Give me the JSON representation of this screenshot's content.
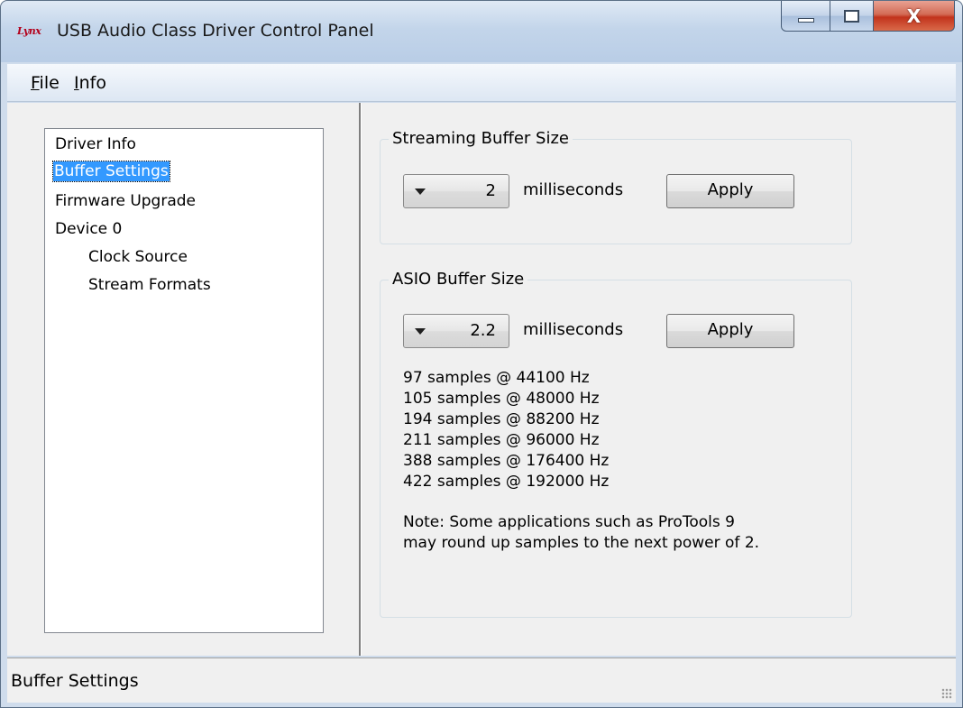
{
  "window": {
    "logo_text": "Lynx",
    "title": "USB Audio Class Driver Control Panel",
    "close_glyph": "X"
  },
  "menu": {
    "file_acc": "F",
    "file_rest": "ile",
    "info_acc": "I",
    "info_rest": "nfo"
  },
  "tree": {
    "items": [
      {
        "label": "Driver Info"
      },
      {
        "label": "Buffer Settings",
        "selected": true
      },
      {
        "label": "Firmware Upgrade"
      },
      {
        "label": "Device 0"
      },
      {
        "label": "Clock Source"
      },
      {
        "label": "Stream Formats"
      }
    ]
  },
  "streaming": {
    "group_label": "Streaming Buffer Size",
    "value": "2",
    "unit": "milliseconds",
    "apply_label": "Apply"
  },
  "asio": {
    "group_label": "ASIO Buffer Size",
    "value": "2.2",
    "unit": "milliseconds",
    "apply_label": "Apply",
    "samples": [
      "97 samples @ 44100 Hz",
      "105 samples @ 48000 Hz",
      "194 samples @ 88200 Hz",
      "211 samples @ 96000 Hz",
      "388 samples @ 176400 Hz",
      "422 samples @ 192000 Hz"
    ],
    "note_line1": "Note: Some applications such as ProTools 9",
    "note_line2": "may round up samples to the next power of 2."
  },
  "status": {
    "text": "Buffer Settings"
  },
  "icons": {
    "minimize": "minimize-icon",
    "maximize": "maximize-icon",
    "close": "close-icon",
    "dropdown": "chevron-down-icon",
    "grip": "resize-grip-icon"
  },
  "colors": {
    "selection": "#3399ff",
    "close_button": "#c2331c",
    "logo": "#b3001b"
  }
}
